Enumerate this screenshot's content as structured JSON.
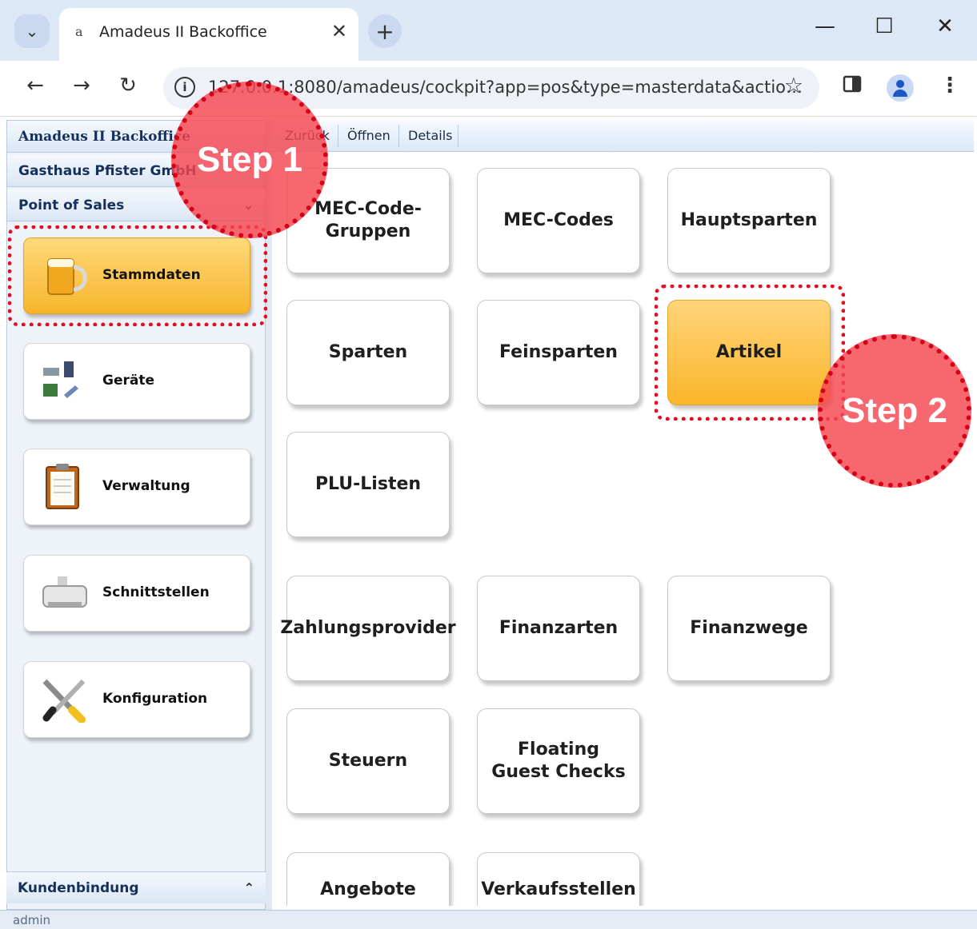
{
  "browser": {
    "tab_title": "Amadeus II Backoffice",
    "tab_favicon": "a",
    "url": "127.0.0.1:8080/amadeus/cockpit?app=pos&type=masterdata&actio…",
    "icons": {
      "tab_list": "chevron-down-icon",
      "new_tab": "plus-icon",
      "back": "back-arrow-icon",
      "forward": "forward-arrow-icon",
      "reload": "reload-icon",
      "site_info": "info-icon",
      "bookmark": "star-icon",
      "side_panel": "side-panel-icon",
      "profile": "profile-icon",
      "menu": "kebab-menu-icon"
    }
  },
  "sidebar": {
    "app_title": "Amadeus II Backoffice",
    "sections": [
      {
        "label": "Gasthaus Pfister GmbH",
        "chevron": "^"
      },
      {
        "label": "Point of Sales",
        "chevron": "v"
      }
    ],
    "items": [
      {
        "label": "Stammdaten",
        "icon": "beer-mug-icon",
        "active": true
      },
      {
        "label": "Geräte",
        "icon": "devices-icon",
        "active": false
      },
      {
        "label": "Verwaltung",
        "icon": "clipboard-icon",
        "active": false
      },
      {
        "label": "Schnittstellen",
        "icon": "printer-icon",
        "active": false
      },
      {
        "label": "Konfiguration",
        "icon": "tools-icon",
        "active": false
      }
    ],
    "footer_section": {
      "label": "Kundenbindung",
      "chevron": "^"
    }
  },
  "main_toolbar": {
    "back": "Zurück",
    "open": "Öffnen",
    "details": "Details"
  },
  "tiles": [
    {
      "label": "MEC-Code-Gruppen",
      "active": false
    },
    {
      "label": "MEC-Codes",
      "active": false
    },
    {
      "label": "Hauptsparten",
      "active": false
    },
    {
      "label": "Sparten",
      "active": false
    },
    {
      "label": "Feinsparten",
      "active": false
    },
    {
      "label": "Artikel",
      "active": true
    },
    {
      "label": "PLU-Listen",
      "active": false
    },
    {
      "label": "Zahlungsprovider",
      "active": false
    },
    {
      "label": "Finanzarten",
      "active": false
    },
    {
      "label": "Finanzwege",
      "active": false
    },
    {
      "label": "Steuern",
      "active": false
    },
    {
      "label": "Floating Guest Checks",
      "active": false
    },
    {
      "label": "Angebote",
      "active": false
    },
    {
      "label": "Verkaufsstellen",
      "active": false
    }
  ],
  "status": {
    "user": "admin"
  },
  "annotations": {
    "step1": "Step 1",
    "step2": "Step 2",
    "color": "#e01020"
  }
}
